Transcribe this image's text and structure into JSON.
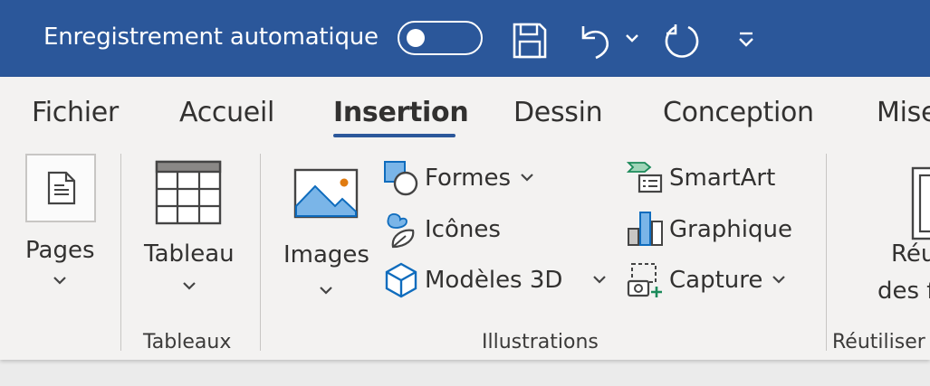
{
  "titlebar": {
    "title": "Enregistrement automatique",
    "autosave_on": false
  },
  "tabs": [
    {
      "label": "Fichier"
    },
    {
      "label": "Accueil"
    },
    {
      "label": "Insertion",
      "active": true
    },
    {
      "label": "Dessin"
    },
    {
      "label": "Conception"
    },
    {
      "label": "Mise"
    }
  ],
  "groups": {
    "pages": {
      "label": "Pages"
    },
    "tableaux": {
      "label": "Tableaux",
      "tableau_label": "Tableau"
    },
    "illustrations": {
      "label": "Illustrations",
      "images_label": "Images",
      "formes_label": "Formes",
      "icones_label": "Icônes",
      "modeles3d_label": "Modèles 3D",
      "smartart_label": "SmartArt",
      "graphique_label": "Graphique",
      "capture_label": "Capture"
    },
    "reutiliser": {
      "label": "Réutiliser",
      "button_line1": "Réu",
      "button_line2": "des f"
    }
  },
  "colors": {
    "titlebar": "#2b579a",
    "accent": "#2b579a",
    "ribbon_bg": "#f3f2f1",
    "icon_blue": "#0f6cbd",
    "icon_green": "#1b8a5a",
    "image_dot": "#e07b10"
  }
}
